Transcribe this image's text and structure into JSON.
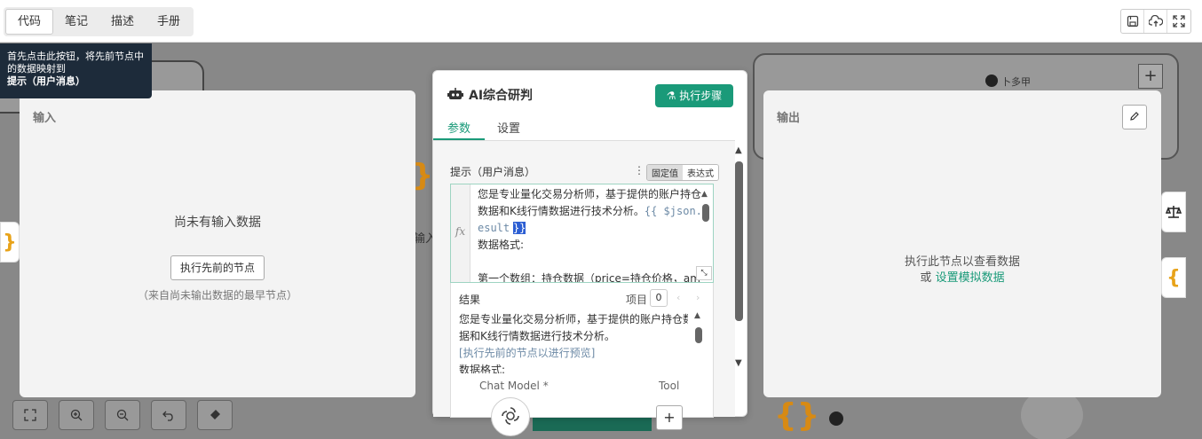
{
  "tabs": [
    "代码",
    "笔记",
    "描述",
    "手册"
  ],
  "tooltip": {
    "text_before": "首先点击此按钮，将先前节点中的数据映射到 ",
    "text_bold": "提示（用户消息）"
  },
  "input_panel": {
    "title": "输入",
    "empty_title": "尚未有输入数据",
    "run_button": "执行先前的节点",
    "hint": "（来自尚未输出数据的最早节点）"
  },
  "node": {
    "title": "AI综合研判",
    "execute_button": "执行步骤",
    "tabs": [
      "参数",
      "设置"
    ],
    "prompt_label": "提示（用户消息）",
    "mode_fixed": "固定值",
    "mode_expression": "表达式",
    "fx_label": "fx",
    "editor_line1": "您是专业量化交易分析师，基于提供的账户持仓",
    "editor_line2": "数据和K线行情数据进行技术分析。",
    "editor_expr1": "{{ $json.r",
    "editor_expr2": "esult",
    "editor_expr_close": "}}",
    "editor_line3": "数据格式:",
    "editor_line4": "第一个数组：持仓数据（price=持仓价格，amo",
    "result_label": "结果",
    "items_label": "项目",
    "items_count": "0",
    "result_line1": "您是专业量化交易分析师，基于提供的账户持仓数",
    "result_line2": "据和K线行情数据进行技术分析。",
    "result_placeholder": "[执行先前的节点以进行预览]",
    "result_line3": "数据格式:",
    "chat_model_label": "Chat Model *",
    "tool_label": "Tool"
  },
  "output_panel": {
    "title": "输出",
    "empty_line1": "执行此节点以查看数据",
    "empty_or": "或",
    "mock_link": "设置模拟数据"
  },
  "canvas": {
    "branch_label": "卜多甲",
    "input_fragment": "输入"
  },
  "colors": {
    "accent": "#1a9a79",
    "tooltip_bg": "#1d2b3a",
    "expression": "#6d8aa6"
  }
}
